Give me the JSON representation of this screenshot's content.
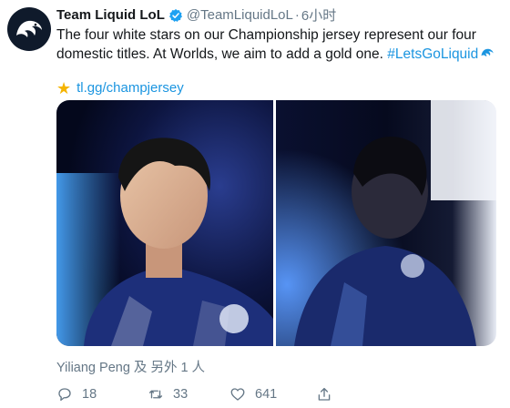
{
  "tweet": {
    "author_name": "Team Liquid LoL",
    "handle": "@TeamLiquidLoL",
    "separator": "·",
    "time": "6小时",
    "text_main": "The four white stars on our Championship jersey represent our four domestic titles. At Worlds, we aim to add a gold one. ",
    "hashtag": "#LetsGoLiquid",
    "link_emoji": "★",
    "link_text": "tl.gg/champjersey",
    "tagged": "Yiliang Peng 及 另外 1 人"
  },
  "actions": {
    "replies": "18",
    "retweets": "33",
    "likes": "641"
  },
  "colors": {
    "link": "#1b95e0",
    "muted": "#657786",
    "star": "#f5b400",
    "verified": "#1da1f2"
  },
  "icons": [
    "team-liquid-logo-icon",
    "verified-badge-icon",
    "star-icon",
    "reply-icon",
    "retweet-icon",
    "like-icon",
    "share-icon"
  ]
}
